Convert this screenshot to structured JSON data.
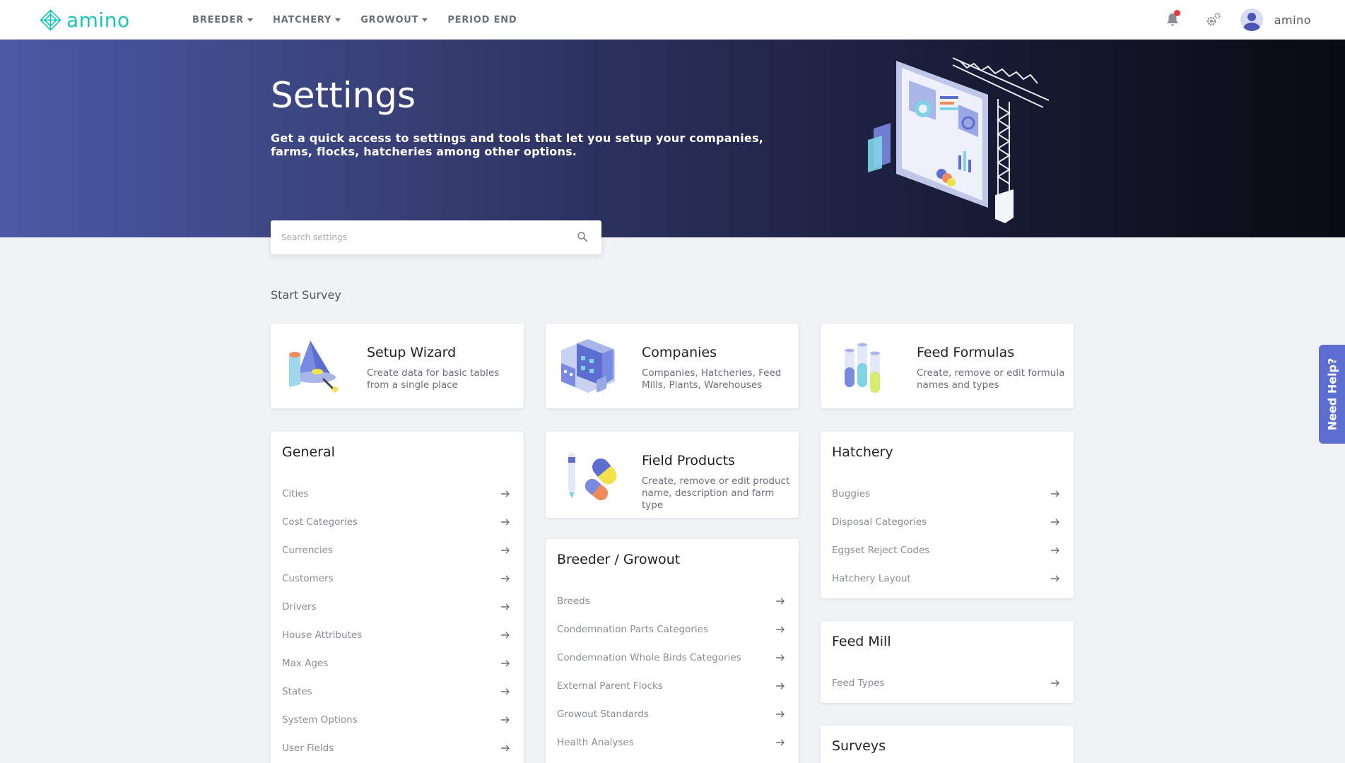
{
  "brand": {
    "name": "amino",
    "color": "#19c6b7"
  },
  "nav": {
    "items": [
      {
        "label": "BREEDER",
        "dropdown": true
      },
      {
        "label": "HATCHERY",
        "dropdown": true
      },
      {
        "label": "GROWOUT",
        "dropdown": true
      },
      {
        "label": "PERIOD END",
        "dropdown": false
      }
    ]
  },
  "user": {
    "name": "amino"
  },
  "icons": {
    "notifications": "bell-icon",
    "settings": "gears-icon",
    "avatar": "user-avatar-icon",
    "search": "search-icon",
    "arrow": "arrow-right-icon"
  },
  "colors": {
    "notification_dot": "#e63a3a",
    "need_help_bg": "#5c6fd0"
  },
  "hero": {
    "title": "Settings",
    "subtitle": "Get a quick access to settings and tools that let you setup your companies, farms, flocks, hatcheries among other options."
  },
  "search": {
    "placeholder": "Search settings",
    "value": ""
  },
  "section_label": "Start Survey",
  "features": [
    {
      "title": "Setup Wizard",
      "description": "Create data for basic tables from a single place",
      "icon": "wizard-hat-icon"
    },
    {
      "title": "Companies",
      "description": "Companies, Hatcheries, Feed Mills, Plants, Warehouses",
      "icon": "buildings-icon"
    },
    {
      "title": "Feed Formulas",
      "description": "Create, remove or edit formula names and types",
      "icon": "test-tubes-icon"
    },
    {
      "title": "Field Products",
      "description": "Create, remove or edit product name, description and farm type",
      "icon": "pills-icon"
    }
  ],
  "general": {
    "title": "General",
    "items": [
      "Cities",
      "Cost Categories",
      "Currencies",
      "Customers",
      "Drivers",
      "House Attributes",
      "Max Ages",
      "States",
      "System Options",
      "User Fields"
    ]
  },
  "breeder_growout": {
    "title": "Breeder / Growout",
    "items": [
      "Breeds",
      "Condemnation Parts Categories",
      "Condemnation Whole Birds Categories",
      "External Parent Flocks",
      "Growout Standards",
      "Health Analyses"
    ]
  },
  "hatchery": {
    "title": "Hatchery",
    "items": [
      "Buggies",
      "Disposal Categories",
      "Eggset Reject Codes",
      "Hatchery Layout"
    ]
  },
  "feed_mill": {
    "title": "Feed Mill",
    "items": [
      "Feed Types"
    ]
  },
  "surveys": {
    "title": "Surveys"
  },
  "need_help": "Need Help?"
}
